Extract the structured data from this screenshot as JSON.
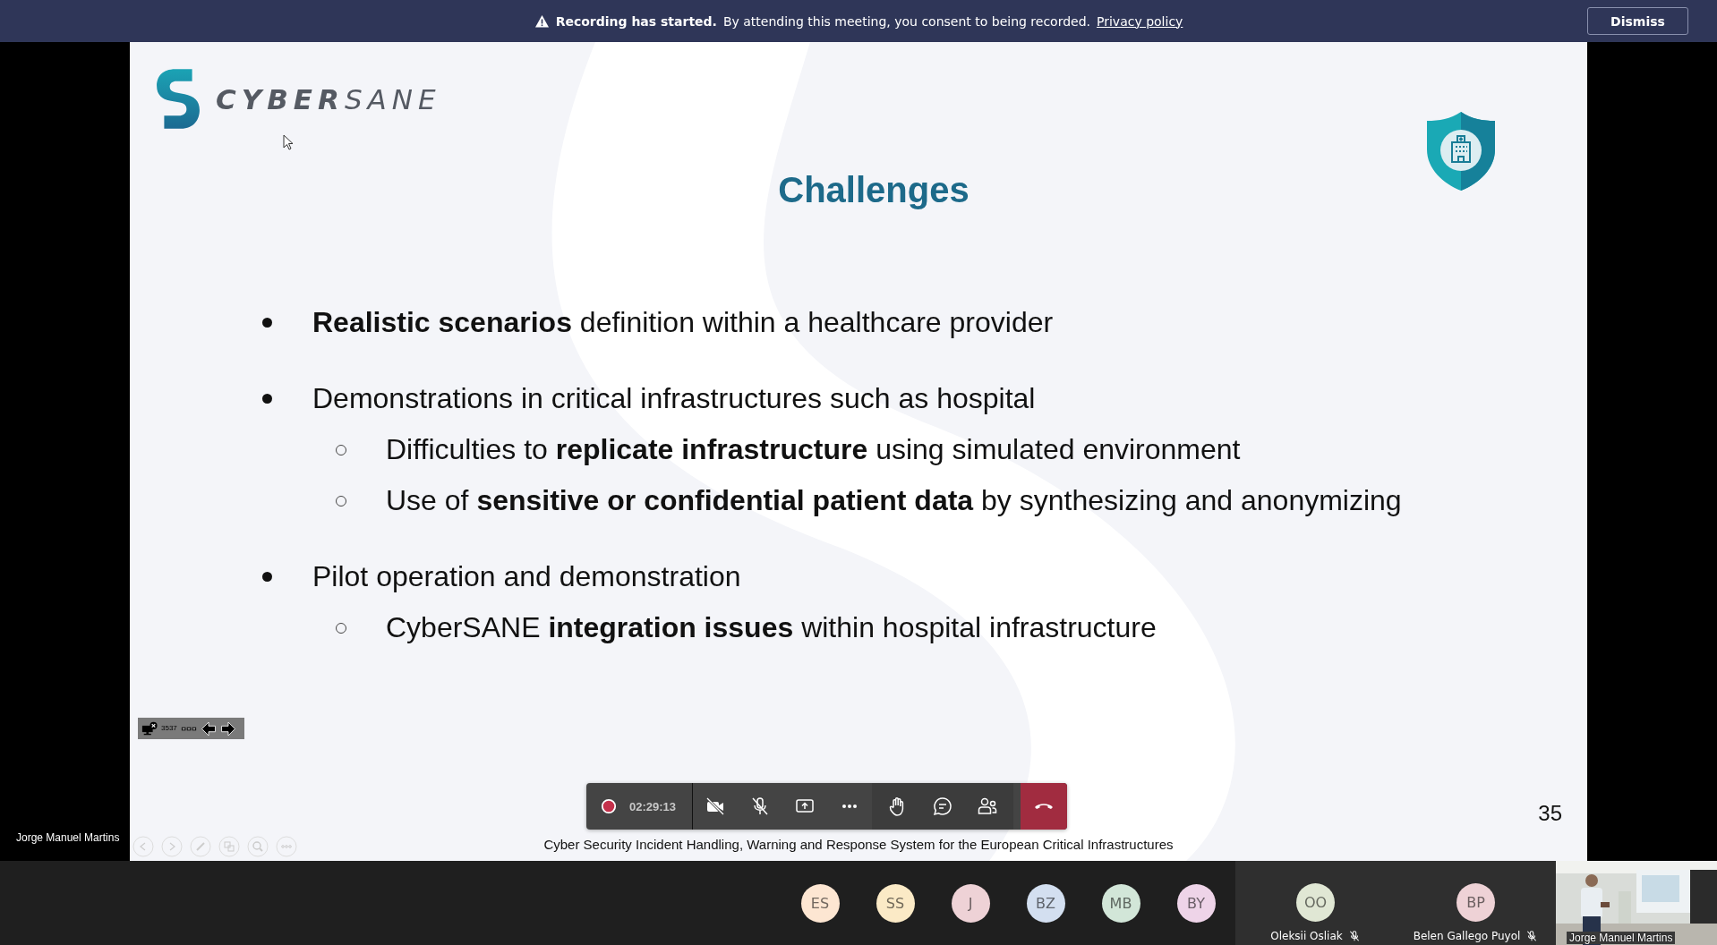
{
  "banner": {
    "title": "Recording has started.",
    "message": "By attending this meeting, you consent to being recorded.",
    "link": "Privacy policy",
    "button": "Dismiss"
  },
  "presenter_label": "Jorge Manuel Martins",
  "slide": {
    "logo": {
      "bold": "CYBER",
      "light": "SANE"
    },
    "title": "Challenges",
    "bullets": [
      {
        "text": "**Realistic scenarios** definition within a healthcare provider"
      },
      {
        "text": "Demonstrations in critical infrastructures such as hospital",
        "children": [
          {
            "text": "Difficulties to **replicate infrastructure** using simulated environment"
          },
          {
            "text": "Use of **sensitive or confidential patient data** by synthesizing and anonymizing"
          }
        ]
      },
      {
        "text": "Pilot operation and demonstration",
        "children": [
          {
            "text": "CyberSANE **integration issues** within hospital infrastructure"
          }
        ]
      }
    ],
    "toolbar": {
      "current": "35",
      "total": "37"
    },
    "page_number": "35",
    "footer": "Cyber Security Incident Handling, Warning and Response System for the European Critical Infrastructures"
  },
  "call_controls": {
    "recording": true,
    "timer": "02:29:13",
    "camera_on": false,
    "mic_muted": true
  },
  "participants": [
    {
      "initials": "ES",
      "color": "#fde6d2"
    },
    {
      "initials": "SS",
      "color": "#fbeac6"
    },
    {
      "initials": "J",
      "color": "#eed2d6"
    },
    {
      "initials": "BZ",
      "color": "#d3dff0"
    },
    {
      "initials": "MB",
      "color": "#d2e6d8"
    },
    {
      "initials": "BY",
      "color": "#eed4e8"
    }
  ],
  "tiles": [
    {
      "initials": "OO",
      "name": "Oleksii Osliak",
      "color": "#e0e7d4",
      "muted": true
    },
    {
      "initials": "BP",
      "name": "Belen Gallego Puyol",
      "color": "#eed2d6",
      "muted": true
    }
  ],
  "video": {
    "name": "Jorge Manuel Martins",
    "kind": "picture"
  }
}
